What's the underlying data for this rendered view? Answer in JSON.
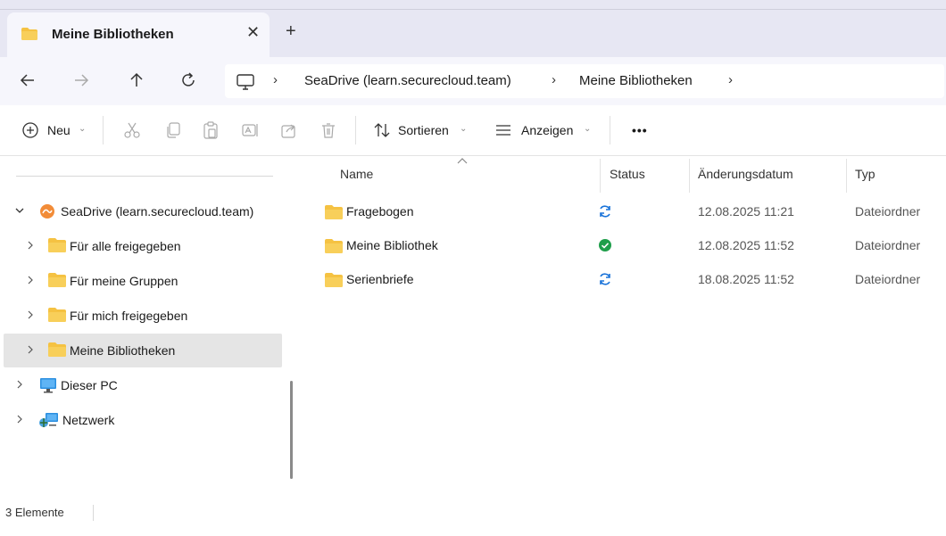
{
  "window": {
    "tab_title": "Meine Bibliotheken",
    "tab_close": "✕",
    "new_tab": "+"
  },
  "address": {
    "crumbs": [
      "SeaDrive (learn.securecloud.team)",
      "Meine Bibliotheken"
    ],
    "separator": "›"
  },
  "toolbar": {
    "new_label": "Neu",
    "sort_label": "Sortieren",
    "view_label": "Anzeigen",
    "more_label": "•••",
    "chevron": "⌄"
  },
  "sidebar": {
    "items": [
      {
        "label": "SeaDrive (learn.securecloud.team)",
        "icon": "seadrive-icon",
        "expanded": true
      },
      {
        "label": "Für alle freigegeben",
        "icon": "folder-icon"
      },
      {
        "label": "Für meine Gruppen",
        "icon": "folder-icon"
      },
      {
        "label": "Für mich freigegeben",
        "icon": "folder-icon"
      },
      {
        "label": "Meine Bibliotheken",
        "icon": "folder-icon",
        "selected": true
      },
      {
        "label": "Dieser PC",
        "icon": "pc-icon"
      },
      {
        "label": "Netzwerk",
        "icon": "network-icon"
      }
    ]
  },
  "columns": {
    "name": "Name",
    "status": "Status",
    "date": "Änderungsdatum",
    "type": "Typ"
  },
  "files": [
    {
      "name": "Fragebogen",
      "status": "sync",
      "date": "12.08.2025 11:21",
      "type": "Dateiordner"
    },
    {
      "name": "Meine Bibliothek",
      "status": "ok",
      "date": "12.08.2025 11:52",
      "type": "Dateiordner"
    },
    {
      "name": "Serienbriefe",
      "status": "sync",
      "date": "18.08.2025 11:52",
      "type": "Dateiordner"
    }
  ],
  "statusbar": {
    "count": "3 Elemente"
  },
  "colors": {
    "folder": "#f5c242",
    "sync_blue": "#1a73d9",
    "ok_green": "#1e9e4a"
  }
}
